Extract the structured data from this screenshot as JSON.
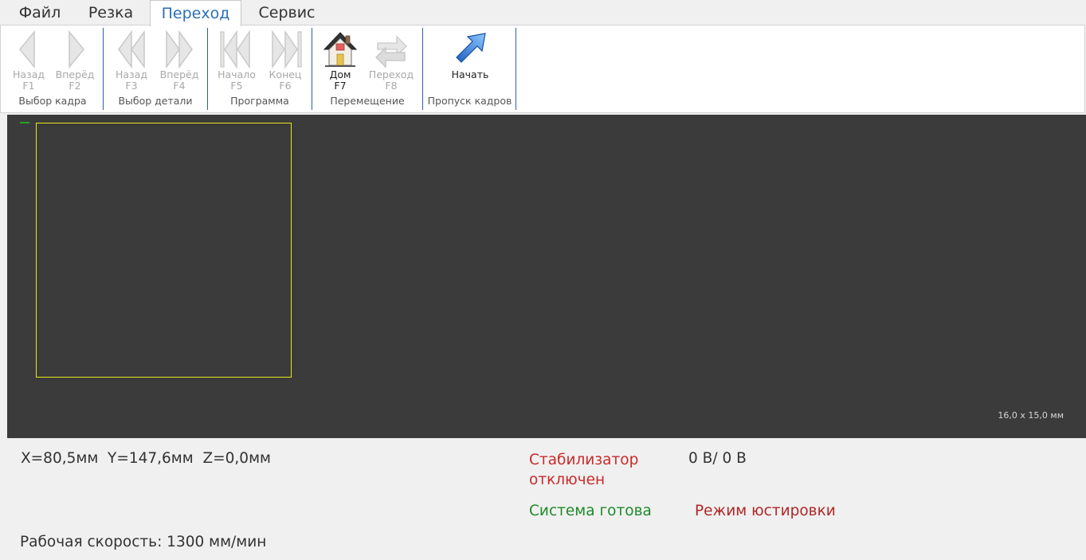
{
  "menu": {
    "tabs": [
      {
        "label": "Файл"
      },
      {
        "label": "Резка"
      },
      {
        "label": "Переход",
        "active": true
      },
      {
        "label": "Сервис"
      }
    ]
  },
  "ribbon": {
    "groups": {
      "frame": {
        "label": "Выбор кадра",
        "back": {
          "label": "Назад",
          "key": "F1",
          "enabled": false
        },
        "forward": {
          "label": "Вперёд",
          "key": "F2",
          "enabled": false
        }
      },
      "part": {
        "label": "Выбор детали",
        "back": {
          "label": "Назад",
          "key": "F3",
          "enabled": false
        },
        "forward": {
          "label": "Вперёд",
          "key": "F4",
          "enabled": false
        }
      },
      "program": {
        "label": "Программа",
        "start": {
          "label": "Начало",
          "key": "F5",
          "enabled": false
        },
        "end": {
          "label": "Конец",
          "key": "F6",
          "enabled": false
        }
      },
      "move": {
        "label": "Перемещение",
        "home": {
          "label": "Дом",
          "key": "F7",
          "enabled": true
        },
        "jump": {
          "label": "Переход",
          "key": "F8",
          "enabled": false
        }
      },
      "skip": {
        "label": "Пропуск кадров",
        "begin": {
          "label": "Начать",
          "enabled": true
        }
      }
    }
  },
  "canvas": {
    "background": "#3b3b3b",
    "sheet_color": "#e6e61a",
    "sheet_size": "16,0 x 15,0 мм"
  },
  "status": {
    "coords": "X=80,5мм  Y=147,6мм  Z=0,0мм",
    "stabilizer": "Стабилизатор отключен",
    "voltage": "0 В/ 0 В",
    "system": "Система готова",
    "mode": "Режим юстировки",
    "speed": "Рабочая скорость: 1300 мм/мин"
  }
}
